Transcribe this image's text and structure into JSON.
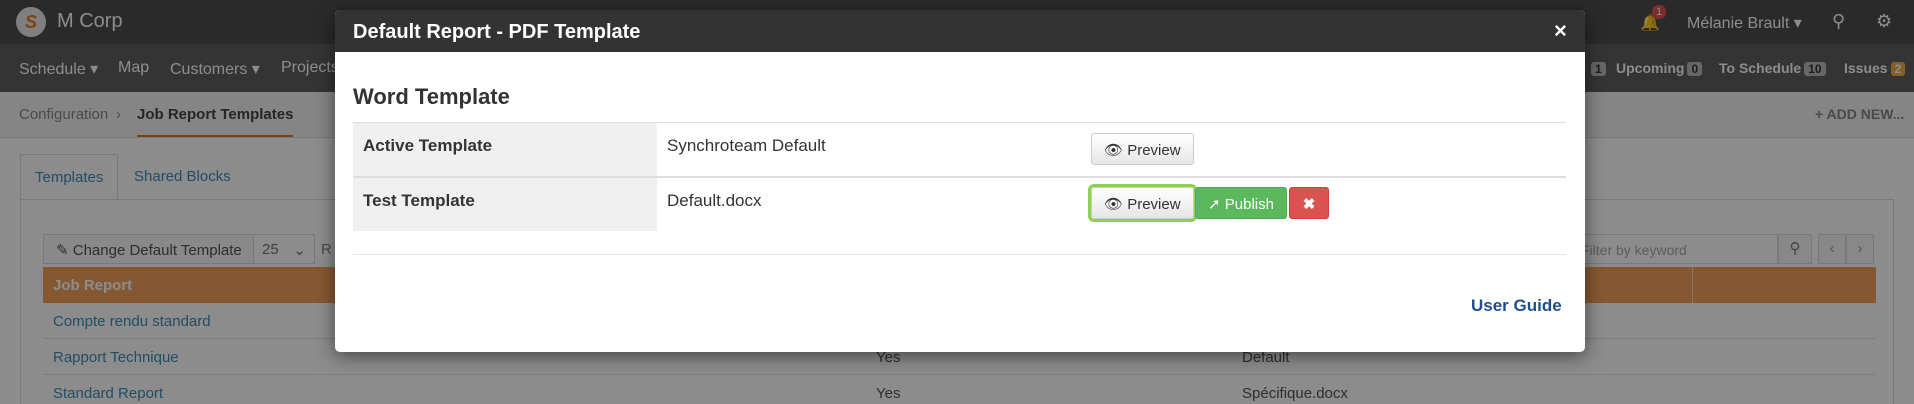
{
  "app": {
    "brand": "M Corp",
    "logo_letter": "S",
    "notification_count": "1",
    "user_name": "Mélanie Brault ▾",
    "search_icon": "search-icon",
    "settings_icon": "gear-icon"
  },
  "nav": {
    "items": [
      "Schedule ▾",
      "Map",
      "Customers ▾",
      "Projects"
    ],
    "right": [
      {
        "label": "Upcoming",
        "count": "0"
      },
      {
        "label": "To Schedule",
        "count": "10"
      },
      {
        "label": "Issues",
        "count": "2"
      }
    ],
    "partial_count": "1"
  },
  "breadcrumb": {
    "items": [
      "Configuration",
      "Job Report Templates"
    ],
    "add_new": "+ ADD NEW..."
  },
  "tabs": [
    "Templates",
    "Shared Blocks"
  ],
  "toolbar": {
    "change_default": "Change Default Template",
    "page_size": "25",
    "rows_label": "R",
    "search_placeholder": "Filter by keyword"
  },
  "table": {
    "header": "Job Report",
    "rows": [
      {
        "name": "Compte rendu standard",
        "active": "",
        "template": ""
      },
      {
        "name": "Rapport Technique",
        "active": "Yes",
        "template": "Default"
      },
      {
        "name": "Standard Report",
        "active": "Yes",
        "template": "Spécifique.docx"
      }
    ]
  },
  "modal": {
    "title": "Default Report - PDF Template",
    "close": "×",
    "section_title": "Word Template",
    "rows": [
      {
        "label": "Active Template",
        "value": "Synchroteam Default"
      },
      {
        "label": "Test Template",
        "value": "Default.docx"
      }
    ],
    "preview_label": "Preview",
    "publish_label": "Publish",
    "delete_label": "✖",
    "user_guide": "User Guide"
  },
  "colors": {
    "accent": "#e07a1f",
    "table_header": "#f3a05a",
    "success": "#5cb85c",
    "danger": "#d9534f",
    "focus_ring": "#8ed24b",
    "link": "#1f4e8c"
  }
}
